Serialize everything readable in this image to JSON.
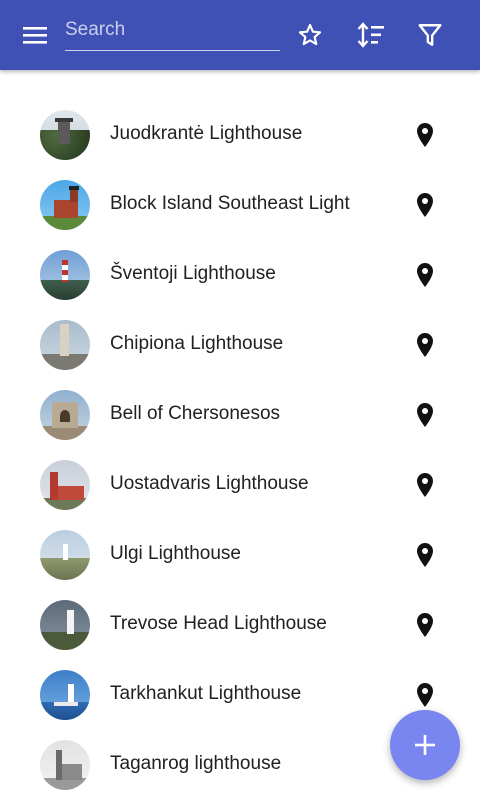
{
  "toolbar": {
    "search_placeholder": "Search",
    "menu_icon": "menu-icon",
    "favorites_icon": "star-outline-icon",
    "sort_icon": "sort-icon",
    "filter_icon": "filter-icon",
    "background_color": "#3f51b5"
  },
  "lighthouses": [
    {
      "name": "Juodkrantė Lighthouse",
      "photo_icon": "lighthouse-photo",
      "location_icon": "map-pin-icon"
    },
    {
      "name": "Block Island Southeast Light",
      "photo_icon": "lighthouse-photo",
      "location_icon": "map-pin-icon"
    },
    {
      "name": "Šventoji Lighthouse",
      "photo_icon": "lighthouse-photo",
      "location_icon": "map-pin-icon"
    },
    {
      "name": "Chipiona Lighthouse",
      "photo_icon": "lighthouse-photo",
      "location_icon": "map-pin-icon"
    },
    {
      "name": "Bell of Chersonesos",
      "photo_icon": "lighthouse-photo",
      "location_icon": "map-pin-icon"
    },
    {
      "name": "Uostadvaris Lighthouse",
      "photo_icon": "lighthouse-photo",
      "location_icon": "map-pin-icon"
    },
    {
      "name": "Ulgi Lighthouse",
      "photo_icon": "lighthouse-photo",
      "location_icon": "map-pin-icon"
    },
    {
      "name": "Trevose Head Lighthouse",
      "photo_icon": "lighthouse-photo",
      "location_icon": "map-pin-icon"
    },
    {
      "name": "Tarkhankut Lighthouse",
      "photo_icon": "lighthouse-photo",
      "location_icon": "map-pin-icon"
    },
    {
      "name": "Taganrog lighthouse",
      "photo_icon": "lighthouse-photo",
      "location_icon": "map-pin-icon"
    }
  ],
  "fab": {
    "icon": "plus-icon",
    "color": "#7986f0"
  }
}
